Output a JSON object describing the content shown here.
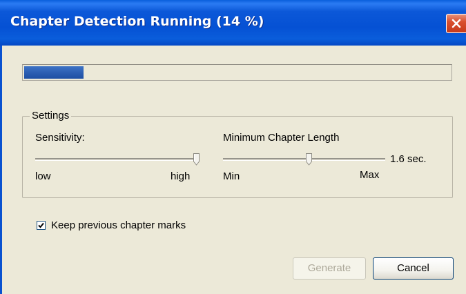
{
  "window": {
    "title": "Chapter Detection Running (14 %)",
    "accent_color": "#0551d4",
    "close_icon": "close-icon"
  },
  "progress": {
    "percent": 14
  },
  "settings": {
    "group_label": "Settings",
    "sensitivity": {
      "label": "Sensitivity:",
      "min_label": "low",
      "max_label": "high",
      "value_fraction": 1.0
    },
    "min_chapter_length": {
      "label": "Minimum Chapter Length",
      "min_label": "Min",
      "max_label": "Max",
      "value_text": "1.6 sec.",
      "value_fraction": 0.53
    }
  },
  "keep_marks": {
    "label": "Keep previous chapter marks",
    "checked": true
  },
  "buttons": {
    "generate": "Generate",
    "cancel": "Cancel"
  }
}
